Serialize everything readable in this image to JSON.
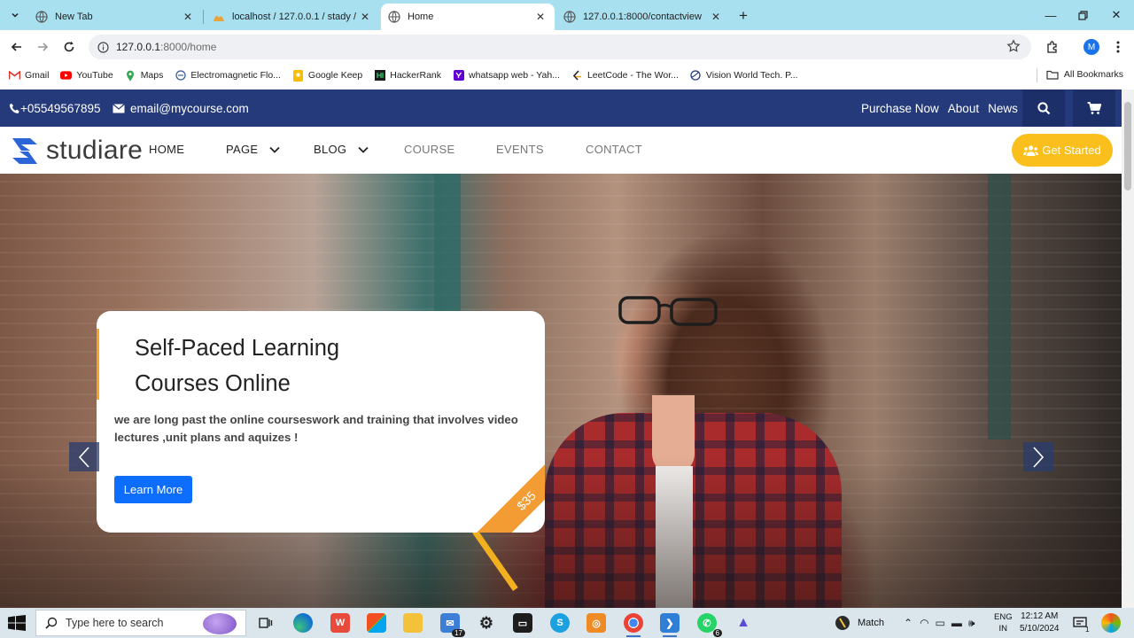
{
  "browser": {
    "tabs": [
      {
        "title": "New Tab",
        "active": false
      },
      {
        "title": "localhost / 127.0.0.1 / stady / co",
        "active": false
      },
      {
        "title": "Home",
        "active": true
      },
      {
        "title": "127.0.0.1:8000/contactview",
        "active": false
      }
    ],
    "url_host": "127.0.0.1",
    "url_path": ":8000/home",
    "profile_initial": "M",
    "bookmarks": [
      {
        "label": "Gmail",
        "icon": "gmail-icon"
      },
      {
        "label": "YouTube",
        "icon": "youtube-icon"
      },
      {
        "label": "Maps",
        "icon": "maps-icon"
      },
      {
        "label": "Electromagnetic Flo...",
        "icon": "web-icon"
      },
      {
        "label": "Google Keep",
        "icon": "keep-icon"
      },
      {
        "label": "HackerRank",
        "icon": "hackerrank-icon"
      },
      {
        "label": "whatsapp web - Yah...",
        "icon": "yahoo-icon"
      },
      {
        "label": "LeetCode - The Wor...",
        "icon": "leetcode-icon"
      },
      {
        "label": "Vision World Tech. P...",
        "icon": "web-icon"
      }
    ],
    "all_bookmarks": "All Bookmarks"
  },
  "site": {
    "phone": "+05549567895",
    "email": "email@mycourse.com",
    "top_links": [
      "Purchase Now",
      "About",
      "News"
    ],
    "logo_text": "studiare",
    "nav": {
      "home": "HOME",
      "page": "PAGE",
      "blog": "BLOG",
      "course": "COURSE",
      "events": "EVENTS",
      "contact": "CONTACT"
    },
    "cta": "Get Started",
    "hero": {
      "title_line1": "Self-Paced Learning",
      "title_line2": "Courses Online",
      "description": "we are long past the online courseswork and training that involves video lectures ,unit plans and aquizes !",
      "button": "Learn More",
      "price": "$35"
    }
  },
  "taskbar": {
    "search_placeholder": "Type here to search",
    "mail_badge": "17",
    "whatsapp_badge": "6",
    "weather": "Match",
    "lang_top": "ENG",
    "lang_bottom": "IN",
    "time": "12:12 AM",
    "date": "5/10/2024",
    "notif_badge": "1"
  },
  "colors": {
    "topbar": "#253a7a",
    "accent_yellow": "#fbbf1d",
    "primary_button": "#0d6efd",
    "ribbon": "#f39c34",
    "logo_blue": "#2a64d6"
  }
}
